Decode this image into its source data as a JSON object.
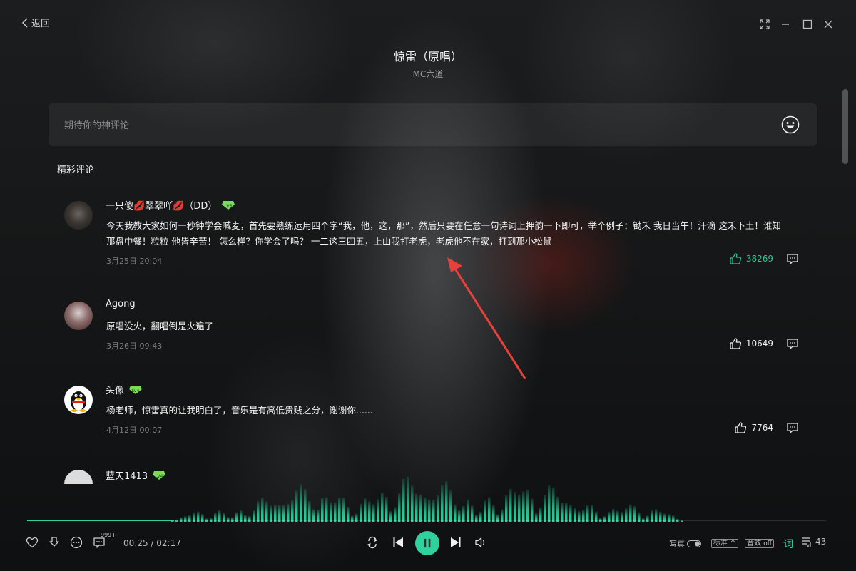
{
  "colors": {
    "accent": "#2fd29c",
    "liked": "#33c28e",
    "annotation_arrow": "#e8413b"
  },
  "header": {
    "back_label": "返回",
    "song_title": "惊雷（原唱）",
    "artist": "MC六道"
  },
  "comment_box": {
    "placeholder": "期待你的神评论",
    "emoji_icon": "smiley-icon"
  },
  "section": {
    "title": "精彩评论"
  },
  "comments": [
    {
      "user": "一只傻💋翠翠吖💋（DD）",
      "level": "LV6",
      "text": "今天我教大家如何一秒钟学会喊麦，首先要熟练运用四个字“我，他，这，那”，然后只要在任意一句诗词上押韵一下即可，举个例子：锄禾 我日当午！汗滴 这禾下土！谁知 那盘中餐！粒粒 他皆辛苦！ 怎么样？你学会了吗？ 一二这三四五，上山我打老虎，老虎他不在家，打到那小松鼠",
      "time": "3月25日 20:04",
      "likes": "38269",
      "liked": true
    },
    {
      "user": "Agong",
      "level": "",
      "text": "原唱没火，翻唱倒是火遍了",
      "time": "3月26日 09:43",
      "likes": "10649",
      "liked": false
    },
    {
      "user": "头像",
      "level": "LV4",
      "text": "杨老师，惊雷真的让我明白了，音乐是有高低贵贱之分，谢谢你......",
      "time": "4月12日 00:07",
      "likes": "7764",
      "liked": false
    },
    {
      "user": "蓝天1413",
      "level": "LV4",
      "text": "",
      "time": "",
      "likes": "",
      "liked": false
    }
  ],
  "player": {
    "progress": 0.184,
    "time_display": "00:25 / 02:17",
    "comment_count_badge": "999+",
    "photo_label": "写真",
    "quality_label": "标准",
    "effect_label": "音效",
    "effect_state": "off",
    "lyrics_label": "词",
    "playlist_count": "43"
  }
}
